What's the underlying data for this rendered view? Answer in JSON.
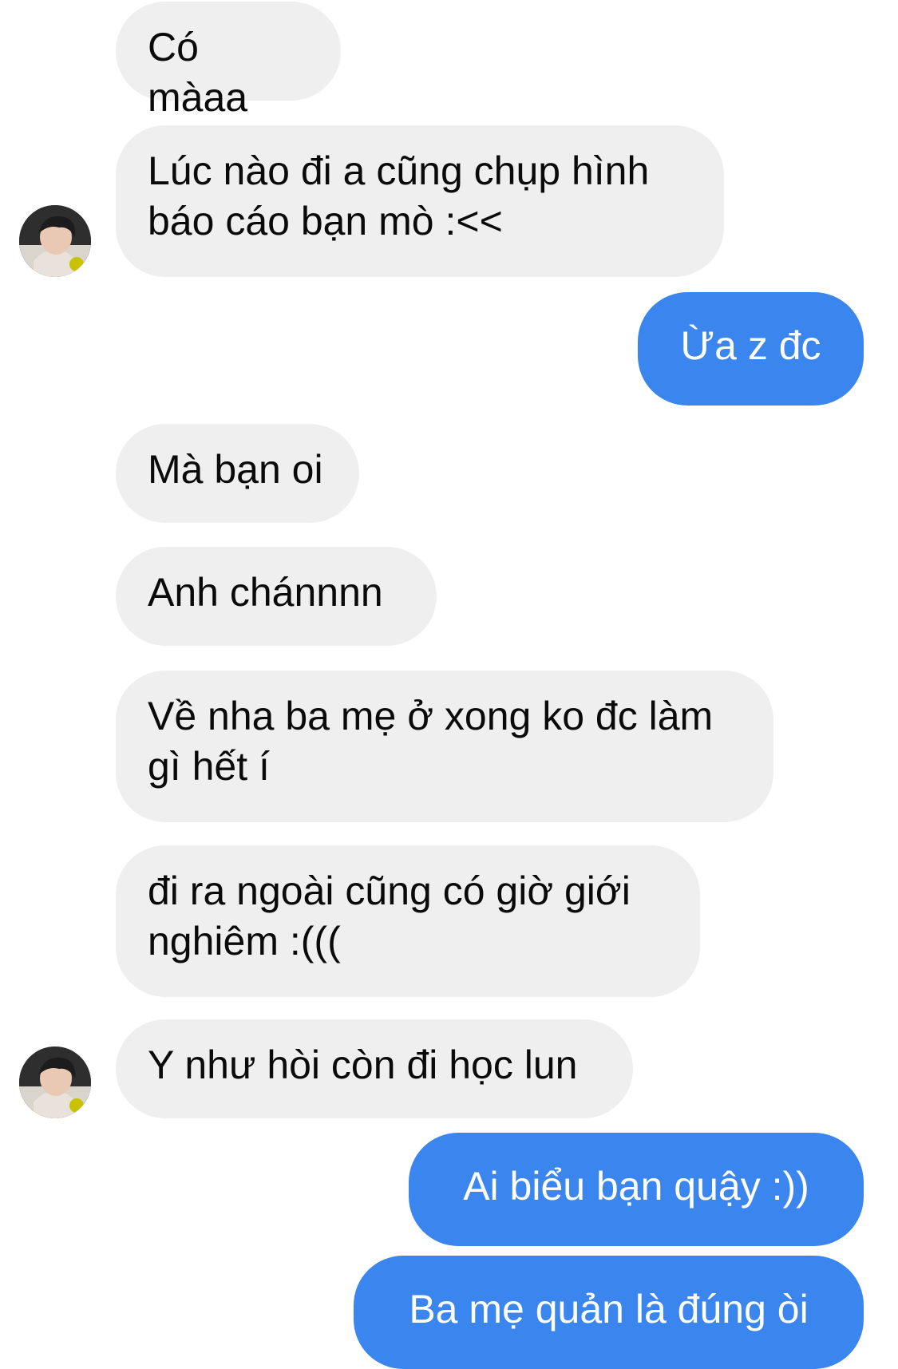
{
  "conversation": {
    "messages": [
      {
        "sender": "them",
        "text": "Có màaa"
      },
      {
        "sender": "them",
        "text": "Lúc nào đi a cũng chụp hình\nbáo cáo bạn mò :<<"
      },
      {
        "sender": "me",
        "text": "Ừa z đc"
      },
      {
        "sender": "them",
        "text": "Mà bạn oi"
      },
      {
        "sender": "them",
        "text": "Anh chánnnn"
      },
      {
        "sender": "them",
        "text": "Về nha ba mẹ ở xong ko đc làm\ngì hết í"
      },
      {
        "sender": "them",
        "text": "đi ra ngoài cũng có giờ giới\nnghiêm :((("
      },
      {
        "sender": "them",
        "text": "Y như hòi còn đi học lun"
      },
      {
        "sender": "me",
        "text": "Ai biểu bạn quậy :))"
      },
      {
        "sender": "me",
        "text": "Ba mẹ quản là đúng òi"
      }
    ]
  },
  "colors": {
    "incoming_bubble": "#efefef",
    "outgoing_bubble": "#3b86ee",
    "background": "#ffffff"
  },
  "icons": {
    "avatar": "contact-avatar-photo"
  }
}
